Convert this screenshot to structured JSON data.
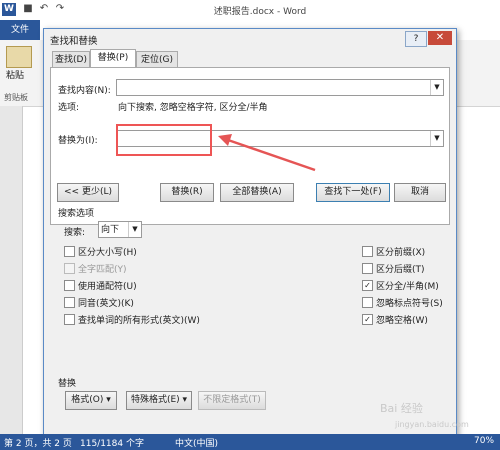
{
  "app": {
    "logo": "W",
    "title": "述职报告.docx - Word",
    "file_tab": "文件",
    "paste_label": "粘贴",
    "clipboard_label": "剪贴板"
  },
  "dialog": {
    "title": "查找和替换",
    "help": "?",
    "close": "✕",
    "tabs": [
      "查找(D)",
      "替换(P)",
      "定位(G)"
    ],
    "active_tab": 1,
    "find_label": "查找内容(N):",
    "find_value": "",
    "options_label": "选项:",
    "options_value": "向下搜索, 忽略空格字符, 区分全/半角",
    "replace_label": "替换为(I):",
    "replace_value": "",
    "buttons": {
      "less": "<< 更少(L)",
      "replace": "替换(R)",
      "replace_all": "全部替换(A)",
      "find_next": "查找下一处(F)",
      "cancel": "取消"
    },
    "search_options_title": "搜索选项",
    "search_label": "搜索:",
    "search_value": "向下",
    "checkboxes_left": [
      {
        "label": "区分大小写(H)",
        "checked": false,
        "disabled": false
      },
      {
        "label": "全字匹配(Y)",
        "checked": false,
        "disabled": true
      },
      {
        "label": "使用通配符(U)",
        "checked": false,
        "disabled": false
      },
      {
        "label": "同音(英文)(K)",
        "checked": false,
        "disabled": false
      },
      {
        "label": "查找单词的所有形式(英文)(W)",
        "checked": false,
        "disabled": false
      }
    ],
    "checkboxes_right": [
      {
        "label": "区分前缀(X)",
        "checked": false,
        "disabled": false
      },
      {
        "label": "区分后缀(T)",
        "checked": false,
        "disabled": false
      },
      {
        "label": "区分全/半角(M)",
        "checked": true,
        "disabled": false
      },
      {
        "label": "忽略标点符号(S)",
        "checked": false,
        "disabled": false
      },
      {
        "label": "忽略空格(W)",
        "checked": true,
        "disabled": false
      }
    ],
    "replace_section_title": "替换",
    "format_button": "格式(O) ▾",
    "special_button": "特殊格式(E) ▾",
    "no_format_button": "不限定格式(T)"
  },
  "status": {
    "page": "第 2 页，共 2 页",
    "words": "115/1184 个字",
    "language": "中文(中国)",
    "zoom": "70%"
  },
  "watermark": "Bai 经验",
  "watermark_url": "jingyan.baidu.com",
  "colors": {
    "accent": "#2b579a",
    "highlight": "#e55555"
  }
}
